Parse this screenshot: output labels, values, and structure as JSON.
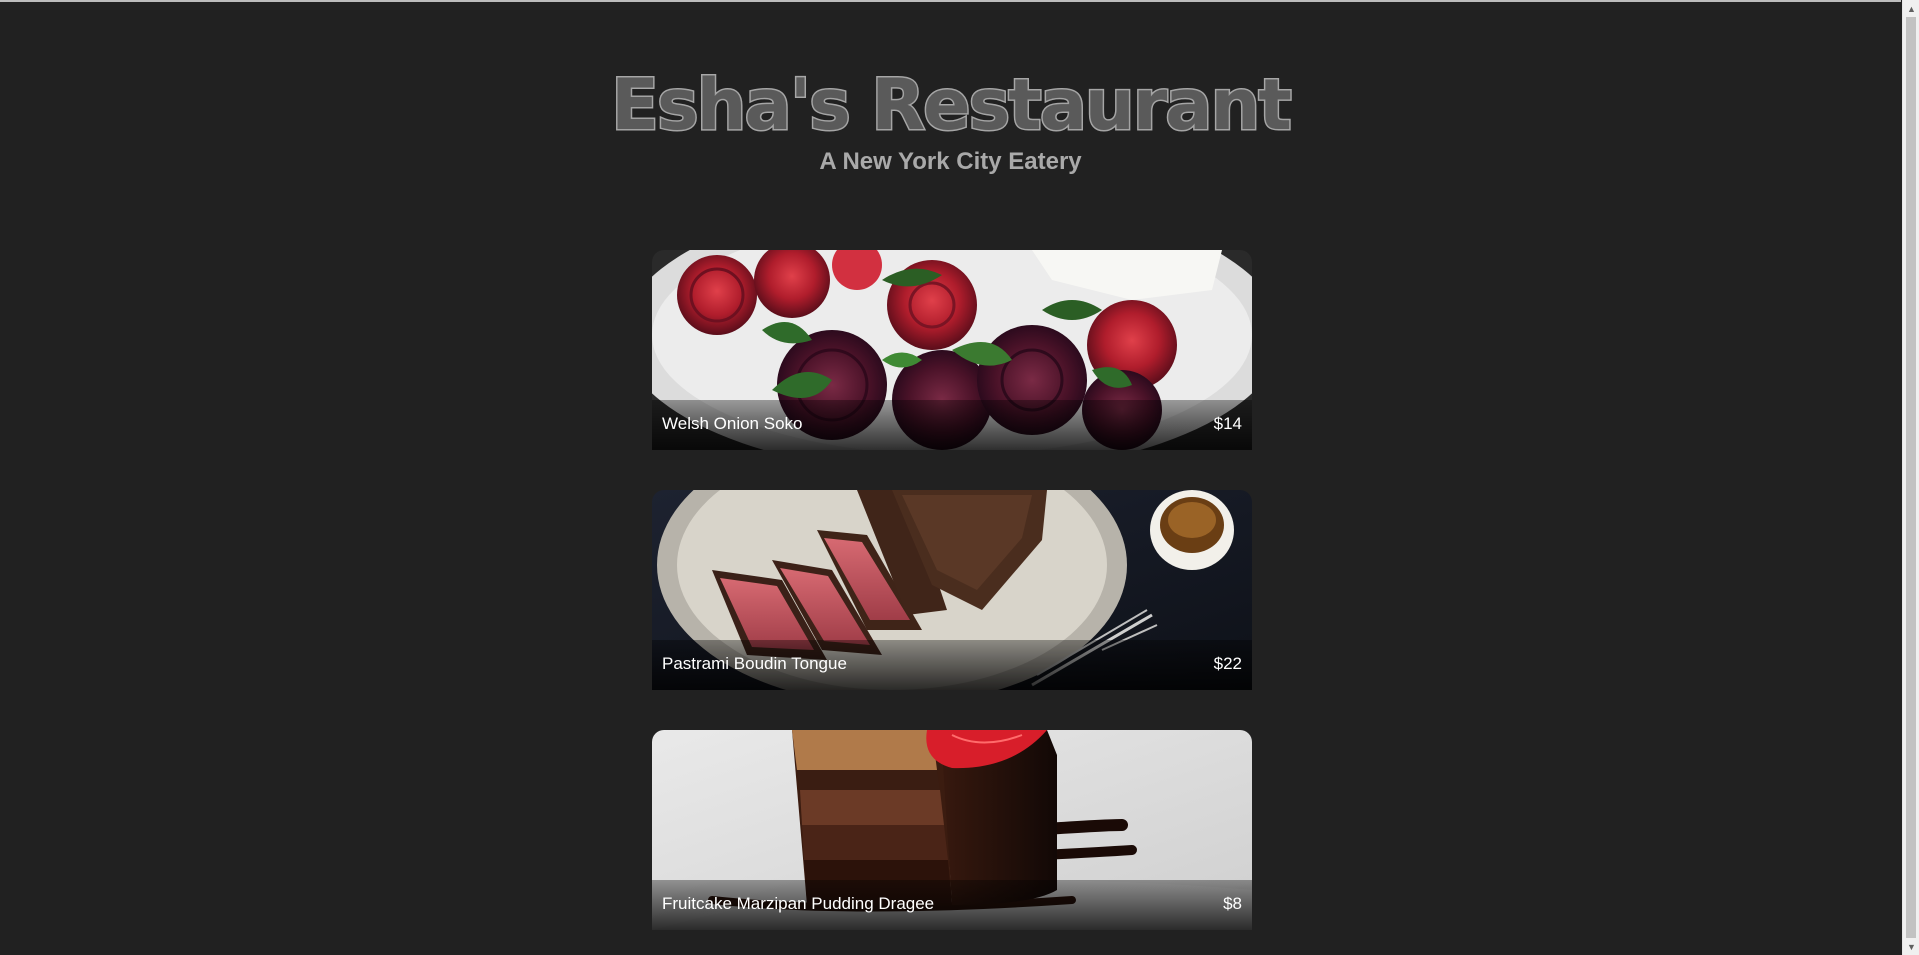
{
  "header": {
    "title": "Esha's Restaurant",
    "subtitle": "A New York City Eatery"
  },
  "menu": {
    "items": [
      {
        "name": "Welsh Onion Soko",
        "price": "$14",
        "image": "roasted-beets-photo"
      },
      {
        "name": "Pastrami Boudin Tongue",
        "price": "$22",
        "image": "sliced-steak-photo"
      },
      {
        "name": "Fruitcake Marzipan Pudding Dragee",
        "price": "$8",
        "image": "chocolate-cake-photo"
      }
    ]
  },
  "colors": {
    "background": "#212121",
    "title_outline": "#a8a8a8",
    "subtitle": "#a9a9a9",
    "caption_text": "#ffffff"
  },
  "icons": {
    "scroll_up": "scroll-up-arrow-icon",
    "scroll_down": "scroll-down-arrow-icon"
  }
}
